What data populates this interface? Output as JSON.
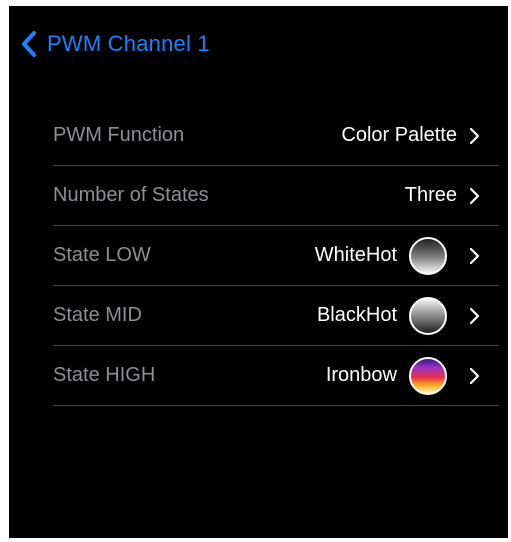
{
  "nav": {
    "back_label": "PWM Channel 1",
    "back_icon": "chevron-left-icon",
    "accent_color": "#1a82fb"
  },
  "rows": [
    {
      "label": "PWM Function",
      "value": "Color Palette",
      "swatch": null
    },
    {
      "label": "Number of States",
      "value": "Three",
      "swatch": null
    },
    {
      "label": "State LOW",
      "value": "WhiteHot",
      "swatch": "whitehot"
    },
    {
      "label": "State MID",
      "value": "BlackHot",
      "swatch": "blackhot"
    },
    {
      "label": "State HIGH",
      "value": "Ironbow",
      "swatch": "ironbow"
    }
  ],
  "colors": {
    "background": "#000000",
    "label_text": "#8e8e93",
    "value_text": "#ffffff",
    "separator": "#4a4a4a"
  }
}
